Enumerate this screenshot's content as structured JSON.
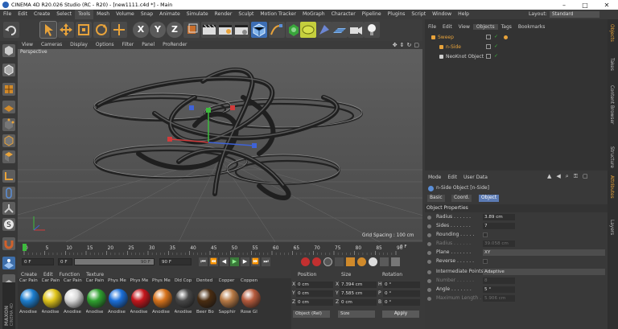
{
  "window": {
    "title": "CINEMA 4D R20.026 Studio (RC - R20) - [new1111.c4d *] - Main",
    "minimize": "–",
    "maximize": "□",
    "close": "✕"
  },
  "menubar": {
    "items": [
      "File",
      "Edit",
      "Create",
      "Select",
      "Tools",
      "Mesh",
      "Volume",
      "Snap",
      "Animate",
      "Simulate",
      "Render",
      "Sculpt",
      "Motion Tracker",
      "MoGraph",
      "Character",
      "Pipeline",
      "Plugins",
      "Script",
      "Window",
      "Help"
    ],
    "active": "Tools",
    "layout_label": "Layout:",
    "layout_value": "Standard"
  },
  "toolbar": {
    "axis_buttons": [
      "X",
      "Y",
      "Z"
    ]
  },
  "viewport": {
    "menu": [
      "View",
      "Cameras",
      "Display",
      "Options",
      "Filter",
      "Panel",
      "ProRender"
    ],
    "camera_label": "Perspective",
    "grid_spacing": "Grid Spacing : 100 cm"
  },
  "timeline": {
    "ticks": [
      "0",
      "5",
      "10",
      "15",
      "20",
      "25",
      "30",
      "35",
      "40",
      "45",
      "50",
      "55",
      "60",
      "65",
      "70",
      "75",
      "80",
      "85",
      "90"
    ],
    "end_label": "0 F"
  },
  "transport": {
    "current_frame": "0 F",
    "start_frame": "0 F",
    "end_frame": "90 F",
    "max_frame": "90 F"
  },
  "materials": {
    "menu": [
      "Create",
      "Edit",
      "Function",
      "Texture"
    ],
    "items": [
      {
        "top": "Car Pain",
        "bottom": "Anodise",
        "color": "#1d7fd0"
      },
      {
        "top": "Car Pain",
        "bottom": "Anodise",
        "color": "#e0c51a"
      },
      {
        "top": "Car Pain",
        "bottom": "Anodise",
        "color": "#d8d8d8"
      },
      {
        "top": "Car Pain",
        "bottom": "Anodise",
        "color": "#2fa12f"
      },
      {
        "top": "Phys Me",
        "bottom": "Anodise",
        "color": "#1b6fd9"
      },
      {
        "top": "Phys Me",
        "bottom": "Anodise",
        "color": "#c4161c"
      },
      {
        "top": "Phys Me",
        "bottom": "Anodise",
        "color": "#d7731c"
      },
      {
        "top": "Old Cop",
        "bottom": "Anodise",
        "color": "#474747"
      },
      {
        "top": "Dented",
        "bottom": "Beer Bo",
        "color": "#4a2d12"
      },
      {
        "top": "Copper",
        "bottom": "Sapphir",
        "color": "#b87a45"
      },
      {
        "top": "Coppen",
        "bottom": "Rose Gl",
        "color": "#b55a3c"
      }
    ]
  },
  "coordinates": {
    "headers": [
      "Position",
      "Size",
      "Rotation"
    ],
    "rows": [
      {
        "axis": "X",
        "pos": "0 cm",
        "size": "7.394 cm",
        "rot_axis": "H",
        "rot": "0 °"
      },
      {
        "axis": "Y",
        "pos": "0 cm",
        "size": "7.585 cm",
        "rot_axis": "P",
        "rot": "0 °"
      },
      {
        "axis": "Z",
        "pos": "0 cm",
        "size": "0 cm",
        "rot_axis": "B",
        "rot": "0 °"
      }
    ],
    "mode": "Object (Rel)",
    "size_mode": "Size",
    "apply": "Apply"
  },
  "objects": {
    "menu": [
      "File",
      "Edit",
      "View",
      "Objects",
      "Tags",
      "Bookmarks"
    ],
    "active_tab": "Objects",
    "tree": [
      {
        "name": "Sweep",
        "indent": 0,
        "color": "#e8a33b"
      },
      {
        "name": "n-Side",
        "indent": 1,
        "color": "#e8a33b"
      },
      {
        "name": "NeoKnot Object",
        "indent": 1,
        "color": "#cfcfcf"
      }
    ]
  },
  "side_tabs_top": [
    "Objects",
    "Takes",
    "Content Browser",
    "Structure"
  ],
  "side_tabs_bottom": [
    "Attributes",
    "Layers"
  ],
  "attributes": {
    "menu": [
      "Mode",
      "Edit",
      "User Data"
    ],
    "object_title": "n-Side Object [n-Side]",
    "tabs": [
      "Basic",
      "Coord.",
      "Object"
    ],
    "active_tab": "Object",
    "section": "Object Properties",
    "props": [
      {
        "label": "Radius . . . . . .",
        "value": "3.89 cm",
        "dim": false
      },
      {
        "label": "Sides . . . . . . .",
        "value": "7",
        "dim": false
      },
      {
        "label": "Rounding . . . . .",
        "value": "",
        "dim": false
      },
      {
        "label": "Radius . . . . . .",
        "value": "39.058 cm",
        "dim": true
      },
      {
        "label": "Plane . . . . . . .",
        "value": "XY",
        "dim": false,
        "wide": true
      },
      {
        "label": "Reverse . . . . . .",
        "value": "",
        "dim": false
      }
    ],
    "interp_label": "Intermediate Points",
    "interp_value": "Adaptive",
    "interp_props": [
      {
        "label": "Number . . . . . .",
        "value": "8",
        "dim": true
      },
      {
        "label": "Angle . . . . . . .",
        "value": "5 °",
        "dim": false
      },
      {
        "label": "Maximum Length . .",
        "value": "5.906 cm",
        "dim": true
      }
    ]
  },
  "brand": {
    "line1": "MAXON",
    "line2": "CINEMA 4D"
  },
  "colors": {
    "accent": "#5b7ab3",
    "orange": "#e8a33b",
    "viewport_bg": "#5f5f5f"
  }
}
